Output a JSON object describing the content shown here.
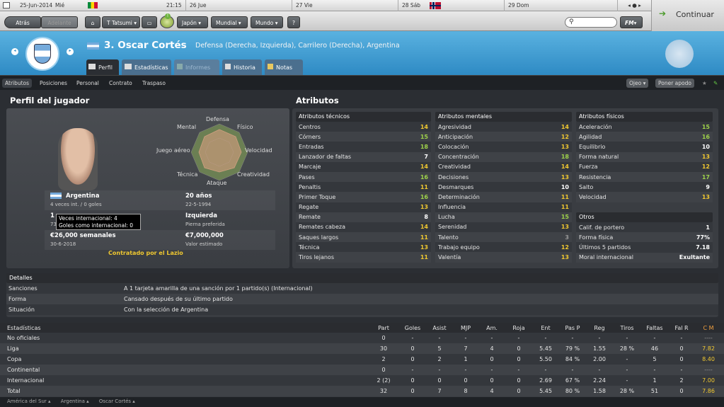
{
  "topbar": {
    "date": "25-Jun-2014",
    "weekday": "Mié",
    "time": "21:15",
    "days": [
      {
        "label": "26 Jue"
      },
      {
        "label": "27 Vie"
      },
      {
        "label": "28 Sáb"
      },
      {
        "label": "29 Dom"
      }
    ]
  },
  "toolbar": {
    "back": "Atrás",
    "forward": "Adelante",
    "manager": "T Tatsumi",
    "menus": [
      "Japón",
      "Mundial",
      "Mundo"
    ],
    "help": "?",
    "fm": "FM",
    "continue": "Continuar"
  },
  "player": {
    "number_name": "3. Oscar Cortés",
    "positions": "Defensa (Derecha, Izquierda), Carrilero (Derecha), Argentina"
  },
  "tabs": [
    {
      "label": "Perfil"
    },
    {
      "label": "Estadísticas"
    },
    {
      "label": "Informes"
    },
    {
      "label": "Historia"
    },
    {
      "label": "Notas"
    }
  ],
  "subtabs": [
    "Atributos",
    "Posiciones",
    "Personal",
    "Contrato",
    "Traspaso"
  ],
  "right_buttons": {
    "ojeo": "Ojeo",
    "poner_apodo": "Poner apodo"
  },
  "profile": {
    "title": "Perfil del jugador",
    "radar_labels": {
      "top": "Defensa",
      "tl": "Mental",
      "tr": "Físico",
      "l": "Juego aéreo",
      "r": "Velocidad",
      "bl": "Técnica",
      "br": "Creatividad",
      "bottom": "Ataque"
    },
    "nation": "Argentina",
    "caps": "4 veces int. / 0 goles",
    "age": "20 años",
    "dob": "22-5-1994",
    "height_partial": "1",
    "weight_partial": "73",
    "foot": "Izquierda",
    "foot_label": "Pierna preferida",
    "wage": "€26,000 semanales",
    "contract_end": "30-6-2018",
    "value": "€7,000,000",
    "value_label": "Valor estimado",
    "contracted": "Contratado por el Lazio",
    "tooltip": {
      "line1": "Veces internacional: 4",
      "line2": "Goles como internacional: 0"
    }
  },
  "attributes": {
    "title": "Atributos",
    "technical": {
      "title": "Atributos técnicos",
      "items": [
        [
          "Centros",
          "14"
        ],
        [
          "Córners",
          "15"
        ],
        [
          "Entradas",
          "18"
        ],
        [
          "Lanzador de faltas",
          "7"
        ],
        [
          "Marcaje",
          "14"
        ],
        [
          "Pases",
          "16"
        ],
        [
          "Penaltis",
          "11"
        ],
        [
          "Primer Toque",
          "16"
        ],
        [
          "Regate",
          "13"
        ],
        [
          "Remate",
          "8"
        ],
        [
          "Remates cabeza",
          "14"
        ],
        [
          "Saques largos",
          "11"
        ],
        [
          "Técnica",
          "13"
        ],
        [
          "Tiros lejanos",
          "11"
        ]
      ]
    },
    "mental": {
      "title": "Atributos mentales",
      "items": [
        [
          "Agresividad",
          "14"
        ],
        [
          "Anticipación",
          "12"
        ],
        [
          "Colocación",
          "13"
        ],
        [
          "Concentración",
          "18"
        ],
        [
          "Creatividad",
          "14"
        ],
        [
          "Decisiones",
          "13"
        ],
        [
          "Desmarques",
          "10"
        ],
        [
          "Determinación",
          "11"
        ],
        [
          "Influencia",
          "11"
        ],
        [
          "Lucha",
          "15"
        ],
        [
          "Serenidad",
          "13"
        ],
        [
          "Talento",
          "3"
        ],
        [
          "Trabajo equipo",
          "12"
        ],
        [
          "Valentía",
          "13"
        ]
      ]
    },
    "physical": {
      "title": "Atributos físicos",
      "items": [
        [
          "Aceleración",
          "15"
        ],
        [
          "Agilidad",
          "16"
        ],
        [
          "Equilibrio",
          "10"
        ],
        [
          "Forma natural",
          "13"
        ],
        [
          "Fuerza",
          "12"
        ],
        [
          "Resistencia",
          "17"
        ],
        [
          "Salto",
          "9"
        ],
        [
          "Velocidad",
          "13"
        ]
      ]
    },
    "others": {
      "title": "Otros",
      "items": [
        [
          "Calif. de portero",
          "1"
        ],
        [
          "Forma física",
          "77%"
        ],
        [
          "Últimos 5 partidos",
          "7.18"
        ],
        [
          "Moral internacional",
          "Exultante"
        ]
      ]
    }
  },
  "details": {
    "title": "Detalles",
    "rows": [
      [
        "Sanciones",
        "A 1 tarjeta amarilla de una sanción por 1 partido(s) (Internacional)"
      ],
      [
        "Forma",
        "Cansado después de su último partido"
      ],
      [
        "Situación",
        "Con la selección de Argentina"
      ]
    ]
  },
  "stats": {
    "title": "Estadísticas",
    "headers": [
      "Part",
      "Goles",
      "Asist",
      "MJP",
      "Am.",
      "Roja",
      "Ent",
      "Pas P",
      "Reg",
      "Tiros",
      "Faltas",
      "Fal R",
      "C M"
    ],
    "rows": [
      {
        "label": "No oficiales",
        "cells": [
          "0",
          "-",
          "-",
          "-",
          "-",
          "-",
          "-",
          "-",
          "-",
          "-",
          "-",
          "-",
          "----"
        ]
      },
      {
        "label": "Liga",
        "cells": [
          "30",
          "0",
          "5",
          "7",
          "4",
          "0",
          "5.45",
          "79 %",
          "1.55",
          "28 %",
          "46",
          "0",
          "7.82"
        ]
      },
      {
        "label": "Copa",
        "cells": [
          "2",
          "0",
          "2",
          "1",
          "0",
          "0",
          "5.50",
          "84 %",
          "2.00",
          "-",
          "5",
          "0",
          "8.40"
        ]
      },
      {
        "label": "Continental",
        "cells": [
          "0",
          "-",
          "-",
          "-",
          "-",
          "-",
          "-",
          "-",
          "-",
          "-",
          "-",
          "-",
          "----"
        ]
      },
      {
        "label": "Internacional",
        "cells": [
          "2 (2)",
          "0",
          "0",
          "0",
          "0",
          "0",
          "2.69",
          "67 %",
          "2.24",
          "-",
          "1",
          "2",
          "7.00"
        ]
      },
      {
        "label": "Total",
        "cells": [
          "32",
          "0",
          "7",
          "8",
          "4",
          "0",
          "5.45",
          "80 %",
          "1.58",
          "28 %",
          "51",
          "0",
          "7.86"
        ]
      }
    ]
  },
  "breadcrumb": [
    "América del Sur",
    "Argentina",
    "Oscar Cortés"
  ]
}
